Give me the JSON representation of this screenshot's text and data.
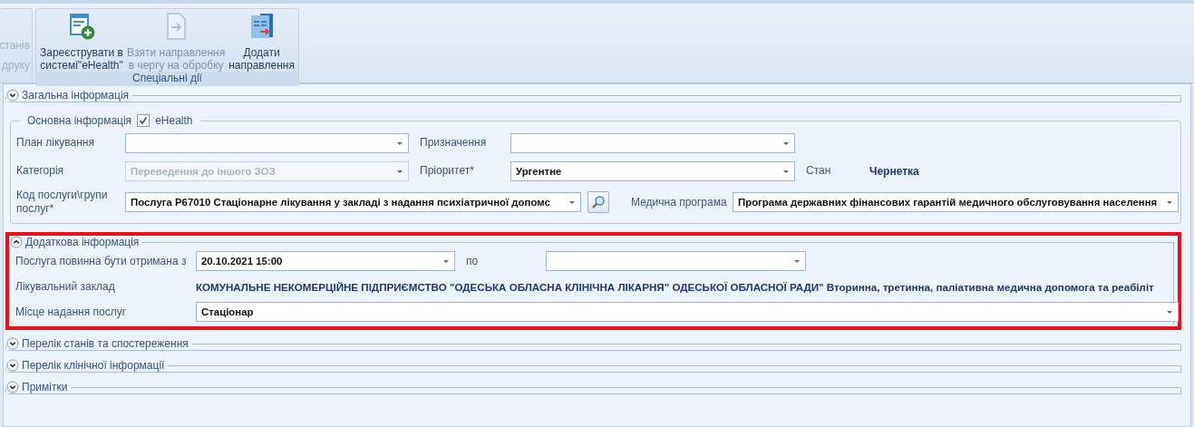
{
  "ribbon": {
    "cut_group": {
      "lines": [
        "станів",
        "друку"
      ]
    },
    "group": {
      "title": "Спеціальні дії",
      "buttons": [
        {
          "kind": "register",
          "lines": [
            "Зареєструвати в",
            "системі\"eHealth\""
          ],
          "disabled": false
        },
        {
          "kind": "queue",
          "lines": [
            "Взяти направлення",
            "в чергу на обробку"
          ],
          "disabled": true
        },
        {
          "kind": "add",
          "lines": [
            "Додати",
            "направлення"
          ],
          "disabled": false
        }
      ]
    }
  },
  "general_section": {
    "title": "Загальна інформація",
    "expanded": false
  },
  "basic_group": {
    "title": "Основна інформація",
    "checkbox": {
      "label": "eHealth",
      "checked": true
    },
    "rows": [
      {
        "fields": [
          {
            "label": "План лікування",
            "kind": "combo",
            "disabled": false
          },
          {
            "label": "Призначення",
            "kind": "combo",
            "disabled": false
          }
        ]
      },
      {
        "fields": [
          {
            "label": "Категорія",
            "kind": "combo",
            "value": "Переведення до іншого ЗОЗ",
            "disabled": true
          },
          {
            "label": "Пріоритет*",
            "kind": "combo",
            "value": "Ургентне",
            "disabled": false
          },
          {
            "label": "Стан",
            "kind": "static",
            "value": "Чернетка"
          }
        ]
      },
      {
        "fields": [
          {
            "label": "Код послуги\\групи послуг*",
            "kind": "combo_search",
            "value": "Послуга Р67010 Стаціонарне лікування у закладі з надання психіатричної допомс",
            "disabled": false
          },
          {
            "label": "Медична програма",
            "kind": "combo",
            "value": "Програма державних фінансових гарантій медичного обслуговування населення",
            "disabled": false
          }
        ]
      }
    ]
  },
  "additional_section": {
    "title": "Додаткова інформація",
    "expanded": true,
    "highlighted": true,
    "service_period": {
      "label": "Послуга повинна бути отримана з",
      "from": "20.10.2021 15:00",
      "to_label": "по"
    },
    "facility": {
      "label": "Лікувальний заклад",
      "value": "КОМУНАЛЬНЕ НЕКОМЕРЦІЙНЕ ПІДПРИЄМСТВО \"ОДЕСЬКА ОБЛАСНА КЛІНІЧНА ЛІКАРНЯ\" ОДЕСЬКОЇ ОБЛАСНОЇ РАДИ\" Вторинна, третинна, паліативна медична допомога та реабіліт"
    },
    "place": {
      "label": "Місце надання послуг",
      "value": "Стаціонар"
    }
  },
  "sections": [
    {
      "title": "Перелік станів та спостереження",
      "expanded": false
    },
    {
      "title": "Перелік клінічної інформації",
      "expanded": false
    },
    {
      "title": "Примітки",
      "expanded": false
    }
  ]
}
